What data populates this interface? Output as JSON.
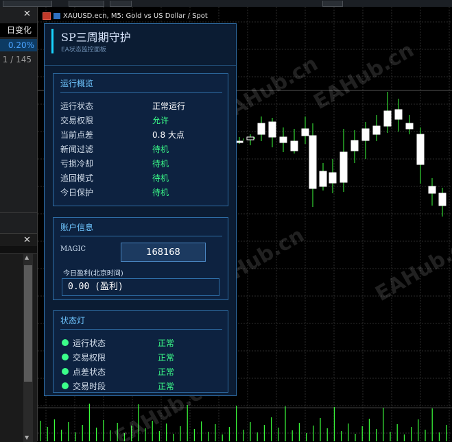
{
  "left_panel": {
    "header": "日变化",
    "change": "0.20%",
    "count": "1 / 145",
    "close_glyph": "✕"
  },
  "chart": {
    "title": "XAUUSD.ecn, M5:  Gold vs US Dollar / Spot",
    "watermark": "EAHub.cn",
    "colors": {
      "up": "#000000",
      "down": "#ffffff",
      "wick": "#3bff3b",
      "grid": "#2b2b2b"
    }
  },
  "ea_panel": {
    "title": "SP三周期守护",
    "subtitle": "EA状态监控面板",
    "overview": {
      "title": "运行概览",
      "rows": [
        {
          "label": "运行状态",
          "value": "正常运行",
          "color": "white"
        },
        {
          "label": "交易权限",
          "value": "允许",
          "color": "green"
        },
        {
          "label": "当前点差",
          "value": "0.8 大点",
          "color": "white"
        },
        {
          "label": "新闻过滤",
          "value": "待机",
          "color": "green"
        },
        {
          "label": "亏损冷却",
          "value": "待机",
          "color": "green"
        },
        {
          "label": "追回模式",
          "value": "待机",
          "color": "green"
        },
        {
          "label": "今日保护",
          "value": "待机",
          "color": "green"
        }
      ]
    },
    "account": {
      "title": "账户信息",
      "magic_label": "MAGIC",
      "magic_value": "168168",
      "pl_label": "今日盈利(北京时间)",
      "pl_value": "0.00  (盈利)"
    },
    "lights": {
      "title": "状态灯",
      "rows": [
        {
          "label": "运行状态",
          "value": "正常"
        },
        {
          "label": "交易权限",
          "value": "正常"
        },
        {
          "label": "点差状态",
          "value": "正常"
        },
        {
          "label": "交易时段",
          "value": "正常"
        }
      ]
    }
  }
}
